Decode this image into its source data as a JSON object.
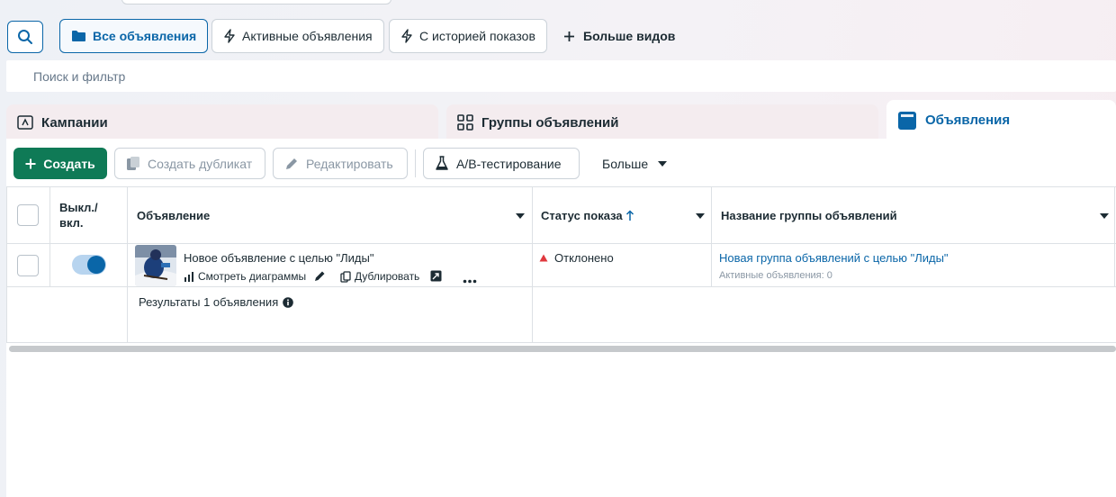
{
  "view_tabs": [
    {
      "label": "Все объявления",
      "icon": "folder-icon",
      "active": true
    },
    {
      "label": "Активные объявления",
      "icon": "lightning-icon",
      "active": false
    },
    {
      "label": "С историей показов",
      "icon": "lightning-icon",
      "active": false
    }
  ],
  "more_views_label": "Больше видов",
  "search": {
    "placeholder": "Поиск и фильтр"
  },
  "level_tabs": [
    {
      "label": "Кампании",
      "icon": "campaign-icon"
    },
    {
      "label": "Группы объявлений",
      "icon": "grid-icon"
    },
    {
      "label": "Объявления",
      "icon": "ad-icon"
    }
  ],
  "toolbar": {
    "create": "Создать",
    "duplicate": "Создать дубликат",
    "edit": "Редактировать",
    "ab_test": "A/B-тестирование",
    "more": "Больше"
  },
  "table": {
    "headers": {
      "toggle": "Выкл./\nвкл.",
      "ad": "Объявление",
      "status": "Статус показа",
      "adset_name": "Название группы объявлений"
    },
    "rows": [
      {
        "ad_name": "Новое объявление с целью \"Лиды\"",
        "action_charts": "Смотреть диаграммы",
        "action_duplicate": "Дублировать",
        "status": "Отклонено",
        "adset_name": "Новая группа объявлений с целью \"Лиды\"",
        "adset_sub": "Активные объявления: 0",
        "toggle_on": true
      }
    ],
    "results": "Результаты 1 объявления"
  },
  "colors": {
    "accent": "#0a66a8",
    "create": "#0f7a56",
    "error": "#e0383e"
  }
}
